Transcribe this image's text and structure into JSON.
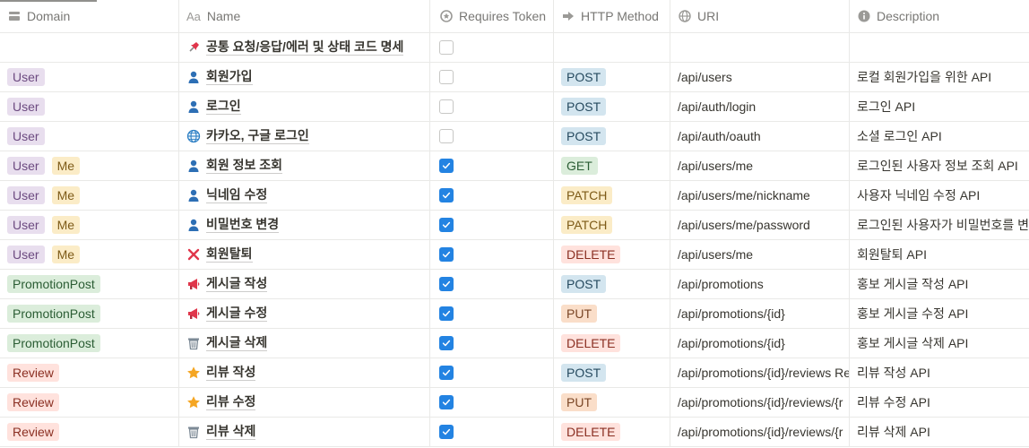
{
  "columns": {
    "domain": "Domain",
    "name": "Name",
    "token": "Requires Token",
    "method": "HTTP Method",
    "uri": "URI",
    "description": "Description"
  },
  "colors": {
    "User": {
      "bg": "#e8deee",
      "fg": "#6c4a80"
    },
    "Me": {
      "bg": "#fbecc7",
      "fg": "#7d5a17"
    },
    "PromotionPost": {
      "bg": "#dbeddb",
      "fg": "#2b5d34"
    },
    "Review": {
      "bg": "#ffe2dd",
      "fg": "#8a2f22"
    },
    "POST": {
      "bg": "#d3e5ef",
      "fg": "#264a5f"
    },
    "GET": {
      "bg": "#dbeddb",
      "fg": "#2b5d34"
    },
    "PATCH": {
      "bg": "#fbecc7",
      "fg": "#7d5a17"
    },
    "DELETE": {
      "bg": "#ffe2dd",
      "fg": "#8a2f22"
    },
    "PUT": {
      "bg": "#fadec9",
      "fg": "#7a4626"
    }
  },
  "rows": [
    {
      "domains": [],
      "icon": "pushpin-icon",
      "name": "공통 요청/응답/에러 및 상태 코드 명세",
      "requires_token": false,
      "method": "",
      "uri": "",
      "description": ""
    },
    {
      "domains": [
        "User"
      ],
      "icon": "person-icon",
      "name": "회원가입",
      "requires_token": false,
      "method": "POST",
      "uri": "/api/users",
      "description": "로컬 회원가입을 위한 API"
    },
    {
      "domains": [
        "User"
      ],
      "icon": "person-icon",
      "name": "로그인",
      "requires_token": false,
      "method": "POST",
      "uri": "/api/auth/login",
      "description": "로그인 API"
    },
    {
      "domains": [
        "User"
      ],
      "icon": "globe-icon",
      "name": "카카오, 구글 로그인",
      "requires_token": false,
      "method": "POST",
      "uri": "/api/auth/oauth",
      "description": "소셜 로그인 API"
    },
    {
      "domains": [
        "User",
        "Me"
      ],
      "icon": "person-icon",
      "name": "회원 정보 조회",
      "requires_token": true,
      "method": "GET",
      "uri": "/api/users/me",
      "description": "로그인된 사용자 정보 조회 API"
    },
    {
      "domains": [
        "User",
        "Me"
      ],
      "icon": "person-icon",
      "name": "닉네임 수정",
      "requires_token": true,
      "method": "PATCH",
      "uri": "/api/users/me/nickname",
      "description": "사용자 닉네임 수정 API"
    },
    {
      "domains": [
        "User",
        "Me"
      ],
      "icon": "person-icon",
      "name": "비밀번호 변경",
      "requires_token": true,
      "method": "PATCH",
      "uri": "/api/users/me/password",
      "description": "로그인된 사용자가 비밀번호를 변"
    },
    {
      "domains": [
        "User",
        "Me"
      ],
      "icon": "cross-mark-icon",
      "name": "회원탈퇴",
      "requires_token": true,
      "method": "DELETE",
      "uri": "/api/users/me",
      "description": "회원탈퇴 API"
    },
    {
      "domains": [
        "PromotionPost"
      ],
      "icon": "megaphone-icon",
      "name": "게시글 작성",
      "requires_token": true,
      "method": "POST",
      "uri": "/api/promotions",
      "description": "홍보 게시글 작성 API"
    },
    {
      "domains": [
        "PromotionPost"
      ],
      "icon": "megaphone-icon",
      "name": "게시글 수정",
      "requires_token": true,
      "method": "PUT",
      "uri": "/api/promotions/{id}",
      "description": "홍보 게시글 수정 API"
    },
    {
      "domains": [
        "PromotionPost"
      ],
      "icon": "trash-icon",
      "name": "게시글 삭제",
      "requires_token": true,
      "method": "DELETE",
      "uri": "/api/promotions/{id}",
      "description": "홍보 게시글 삭제 API"
    },
    {
      "domains": [
        "Review"
      ],
      "icon": "star-icon",
      "name": "리뷰 작성",
      "requires_token": true,
      "method": "POST",
      "uri": "/api/promotions/{id}/reviews Re",
      "description": "리뷰 작성 API"
    },
    {
      "domains": [
        "Review"
      ],
      "icon": "star-icon",
      "name": "리뷰 수정",
      "requires_token": true,
      "method": "PUT",
      "uri": "/api/promotions/{id}/reviews/{r",
      "description": "리뷰 수정 API"
    },
    {
      "domains": [
        "Review"
      ],
      "icon": "trash-icon",
      "name": "리뷰 삭제",
      "requires_token": true,
      "method": "DELETE",
      "uri": "/api/promotions/{id}/reviews/{r",
      "description": "리뷰 삭제 API"
    }
  ]
}
